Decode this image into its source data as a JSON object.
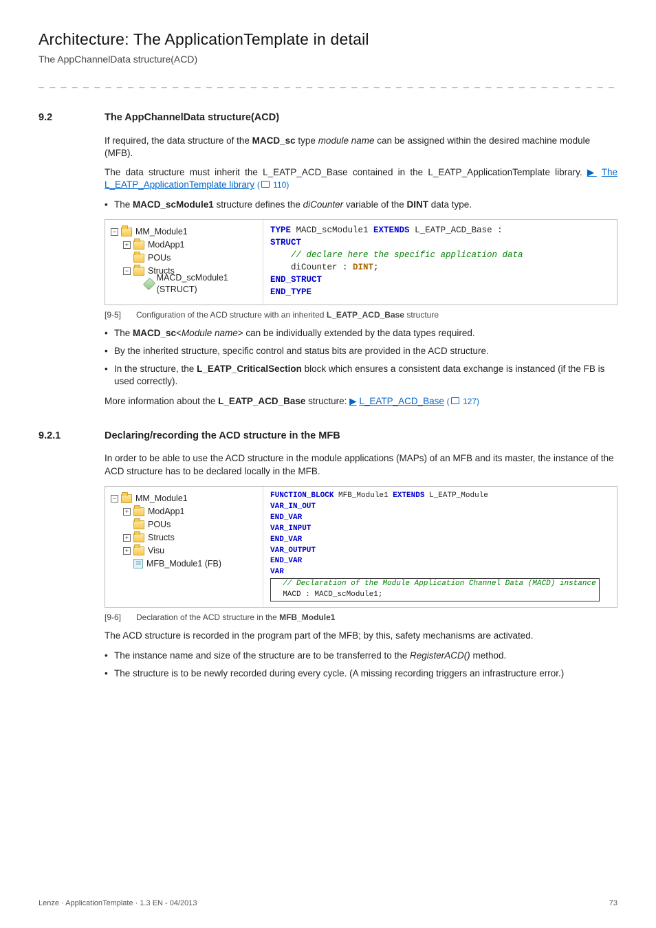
{
  "header": {
    "title": "Architecture: The ApplicationTemplate in detail",
    "subtitle": "The AppChannelData structure(ACD)",
    "dashes": "_ _ _ _ _ _ _ _ _ _ _ _ _ _ _ _ _ _ _ _ _ _ _ _ _ _ _ _ _ _ _ _ _ _ _ _ _ _ _ _ _ _ _ _ _ _ _ _ _ _ _ _ _ _ _ _ _ _ _ _ _ _ _ _"
  },
  "section92": {
    "num": "9.2",
    "title": "The AppChannelData structure(ACD)",
    "p1_a": "If required, the data structure of the ",
    "p1_b": "MACD_sc",
    "p1_c": " type ",
    "p1_d": "module name",
    "p1_e": " can be assigned within the desired machine module (MFB).",
    "p2_a": "The data structure must inherit the L_EATP_ACD_Base contained in the L_EATP_ApplicationTemplate library.  ",
    "p2_link": "The L_EATP_ApplicationTemplate library",
    "p2_pg": " 110)",
    "b1_a": "The ",
    "b1_b": "MACD_scModule1",
    "b1_c": " structure defines the ",
    "b1_d": "diCounter",
    "b1_e": " variable of the ",
    "b1_f": "DINT",
    "b1_g": " data type."
  },
  "fig95": {
    "tree": {
      "n1": "MM_Module1",
      "n2": "ModApp1",
      "n3": "POUs",
      "n4": "Structs",
      "n5": "MACD_scModule1 (STRUCT)"
    },
    "code": {
      "l1a": "TYPE",
      "l1b": " MACD_scModule1 ",
      "l1c": "EXTENDS",
      "l1d": " L_EATP_ACD_Base :",
      "l2": "STRUCT",
      "l3": "    // declare here the specific application data",
      "l4a": "    diCounter : ",
      "l4b": "DINT",
      "l4c": ";",
      "l5": "END_STRUCT",
      "l6": "END_TYPE"
    },
    "capnum": "[9-5]",
    "cap_a": "Configuration of the ACD structure with an inherited ",
    "cap_b": "L_EATP_ACD_Base",
    "cap_c": " structure"
  },
  "post95": {
    "b1_a": "The ",
    "b1_b": "MACD_sc",
    "b1_c": "<",
    "b1_d": "Module name",
    "b1_e": "> can be individually extended by the data types required.",
    "b2": "By the inherited structure, specific control and status bits are provided in the ACD structure.",
    "b3_a": "In the structure, the ",
    "b3_b": "L_EATP_CriticalSection",
    "b3_c": " block which ensures a consistent data exchange is instanced (if the FB is used correctly).",
    "m1_a": "More information about the ",
    "m1_b": "L_EATP_ACD_Base",
    "m1_c": " structure:  ",
    "m1_link": "L_EATP_ACD_Base",
    "m1_pg": " 127)"
  },
  "section921": {
    "num": "9.2.1",
    "title": "Declaring/recording the ACD structure in the MFB",
    "p1": "In order to be able to use the ACD structure in the module applications (MAPs) of an MFB and its master, the instance of the ACD structure has to be declared locally in the MFB."
  },
  "fig96": {
    "tree": {
      "n1": "MM_Module1",
      "n2": "ModApp1",
      "n3": "POUs",
      "n4": "Structs",
      "n5": "Visu",
      "n6": "MFB_Module1 (FB)"
    },
    "code": {
      "l1a": "FUNCTION_BLOCK",
      "l1b": " MFB_Module1 ",
      "l1c": "EXTENDS",
      "l1d": " L_EATP_Module",
      "l2": "VAR_IN_OUT",
      "l3": "END_VAR",
      "l4": "VAR_INPUT",
      "l5": "END_VAR",
      "l6": "VAR_OUTPUT",
      "l7": "END_VAR",
      "l8": "VAR",
      "l9": "  // Declaration of the Module Application Channel Data (MACD) instance",
      "l10": "  MACD : MACD_scModule1;"
    },
    "capnum": "[9-6]",
    "cap_a": "Declaration of the ACD structure in the ",
    "cap_b": "MFB_Module1"
  },
  "post96": {
    "p1": "The ACD structure is recorded in the program part of the MFB; by this, safety mechanisms are activated.",
    "b1_a": "The instance name and size of the structure are to be transferred to the ",
    "b1_b": "RegisterACD()",
    "b1_c": " method.",
    "b2": "The structure is to be newly recorded during every cycle. (A missing recording triggers an infrastructure error.)"
  },
  "footer": {
    "left": "Lenze · ApplicationTemplate · 1.3 EN - 04/2013",
    "right": "73"
  },
  "glyphs": {
    "tri": "▶",
    "dot": "•",
    "plus": "+",
    "minus": "−"
  }
}
